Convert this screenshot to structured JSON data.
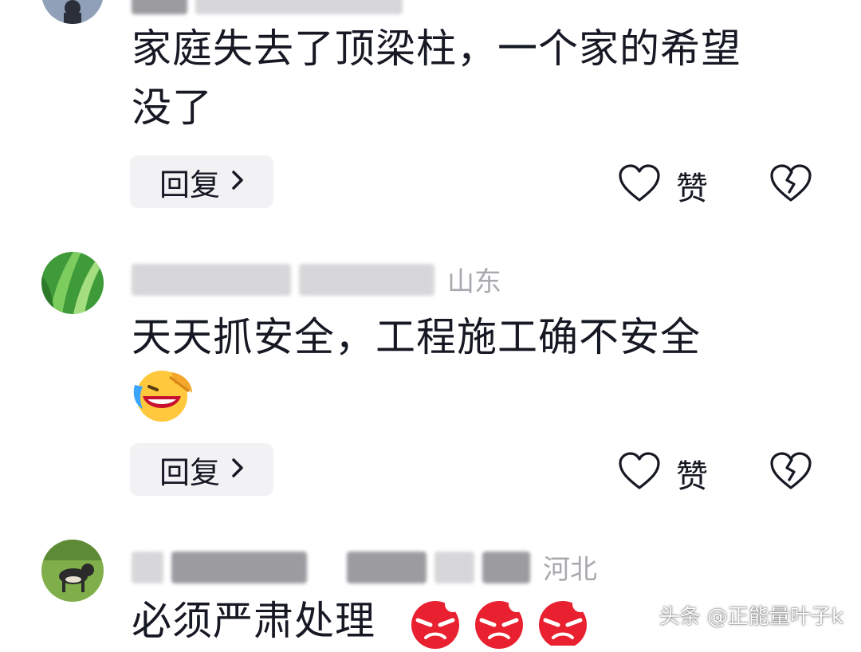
{
  "comments": [
    {
      "location": "",
      "text_line1": "家庭失去了顶梁柱，一个家的希望",
      "text_line2": "没了",
      "reply_label": "回复",
      "like_label": "赞"
    },
    {
      "location": "山东",
      "text": "天天抓安全，工程施工确不安全",
      "emoji": "laughing-crying-emoji",
      "reply_label": "回复",
      "like_label": "赞"
    },
    {
      "location": "河北",
      "text": "必须严肃处理",
      "emoji": "angry-face-emoji"
    }
  ],
  "icons": {
    "reply_chevron": "chevron-right-icon",
    "like": "heart-outline-icon",
    "dislike": "broken-heart-icon"
  },
  "watermark": "头条 @正能量叶子k",
  "colors": {
    "text": "#161823",
    "meta": "#a8a9ae",
    "reply_bg": "#f2f2f4",
    "angry_emoji": "#e8202f",
    "laugh_emoji": "#ffc83d"
  }
}
